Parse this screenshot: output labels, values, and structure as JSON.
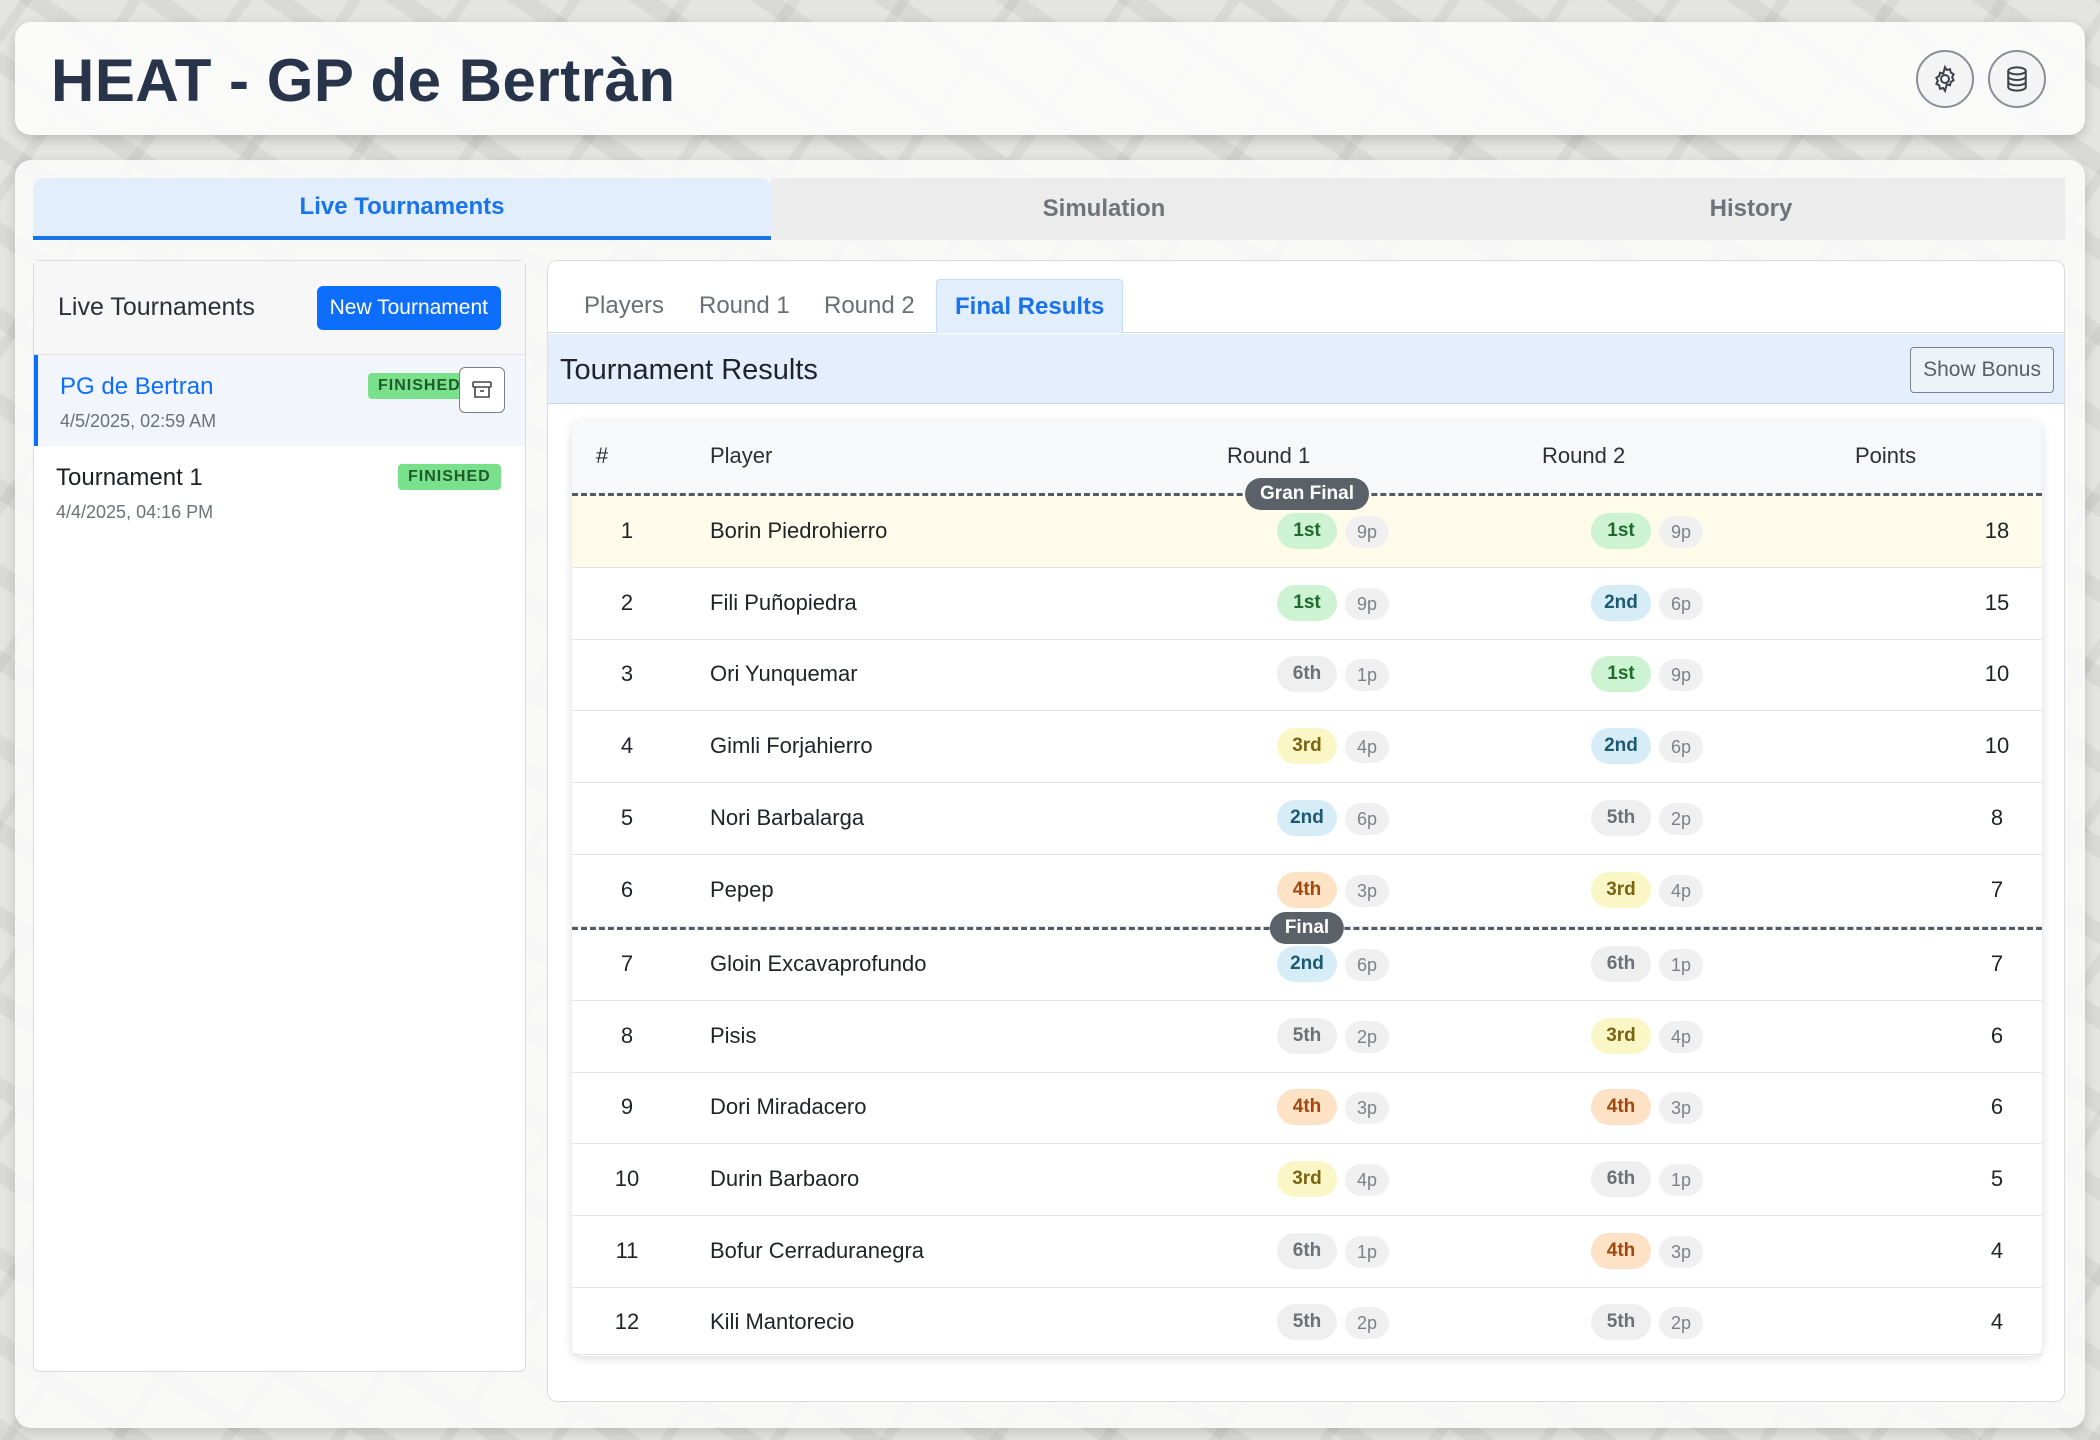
{
  "app": {
    "title": "HEAT - GP de Bertràn",
    "settings_icon": "gear-icon",
    "database_icon": "database-icon"
  },
  "main_tabs": [
    {
      "label": "Live Tournaments",
      "active": true
    },
    {
      "label": "Simulation",
      "active": false
    },
    {
      "label": "History",
      "active": false
    }
  ],
  "sidebar": {
    "title": "Live Tournaments",
    "new_button": "New Tournament",
    "tournaments": [
      {
        "name": "PG de Bertran",
        "date": "4/5/2025, 02:59 AM",
        "status": "FINISHED",
        "active": true
      },
      {
        "name": "Tournament 1",
        "date": "4/4/2025, 04:16 PM",
        "status": "FINISHED",
        "active": false
      }
    ]
  },
  "sub_tabs": [
    {
      "label": "Players",
      "active": false
    },
    {
      "label": "Round 1",
      "active": false
    },
    {
      "label": "Round 2",
      "active": false
    },
    {
      "label": "Final Results",
      "active": true
    }
  ],
  "results": {
    "title": "Tournament Results",
    "bonus_button": "Show Bonus",
    "columns": {
      "rank": "#",
      "player": "Player",
      "round1": "Round 1",
      "round2": "Round 2",
      "points": "Points"
    },
    "dividers": {
      "gran_final": "Gran Final",
      "final": "Final"
    },
    "rows": [
      {
        "rank": "1",
        "player": "Borin Piedrohierro",
        "r1": "1st",
        "r1p": "9p",
        "r2": "1st",
        "r2p": "9p",
        "points": "18"
      },
      {
        "rank": "2",
        "player": "Fili Puñopiedra",
        "r1": "1st",
        "r1p": "9p",
        "r2": "2nd",
        "r2p": "6p",
        "points": "15"
      },
      {
        "rank": "3",
        "player": "Ori Yunquemar",
        "r1": "6th",
        "r1p": "1p",
        "r2": "1st",
        "r2p": "9p",
        "points": "10"
      },
      {
        "rank": "4",
        "player": "Gimli Forjahierro",
        "r1": "3rd",
        "r1p": "4p",
        "r2": "2nd",
        "r2p": "6p",
        "points": "10"
      },
      {
        "rank": "5",
        "player": "Nori Barbalarga",
        "r1": "2nd",
        "r1p": "6p",
        "r2": "5th",
        "r2p": "2p",
        "points": "8"
      },
      {
        "rank": "6",
        "player": "Pepep",
        "r1": "4th",
        "r1p": "3p",
        "r2": "3rd",
        "r2p": "4p",
        "points": "7"
      },
      {
        "rank": "7",
        "player": "Gloin Excavaprofundo",
        "r1": "2nd",
        "r1p": "6p",
        "r2": "6th",
        "r2p": "1p",
        "points": "7"
      },
      {
        "rank": "8",
        "player": "Pisis",
        "r1": "5th",
        "r1p": "2p",
        "r2": "3rd",
        "r2p": "4p",
        "points": "6"
      },
      {
        "rank": "9",
        "player": "Dori Miradacero",
        "r1": "4th",
        "r1p": "3p",
        "r2": "4th",
        "r2p": "3p",
        "points": "6"
      },
      {
        "rank": "10",
        "player": "Durin Barbaoro",
        "r1": "3rd",
        "r1p": "4p",
        "r2": "6th",
        "r2p": "1p",
        "points": "5"
      },
      {
        "rank": "11",
        "player": "Bofur Cerraduranegra",
        "r1": "6th",
        "r1p": "1p",
        "r2": "4th",
        "r2p": "3p",
        "points": "4"
      },
      {
        "rank": "12",
        "player": "Kili Mantorecio",
        "r1": "5th",
        "r1p": "2p",
        "r2": "5th",
        "r2p": "2p",
        "points": "4"
      }
    ]
  }
}
